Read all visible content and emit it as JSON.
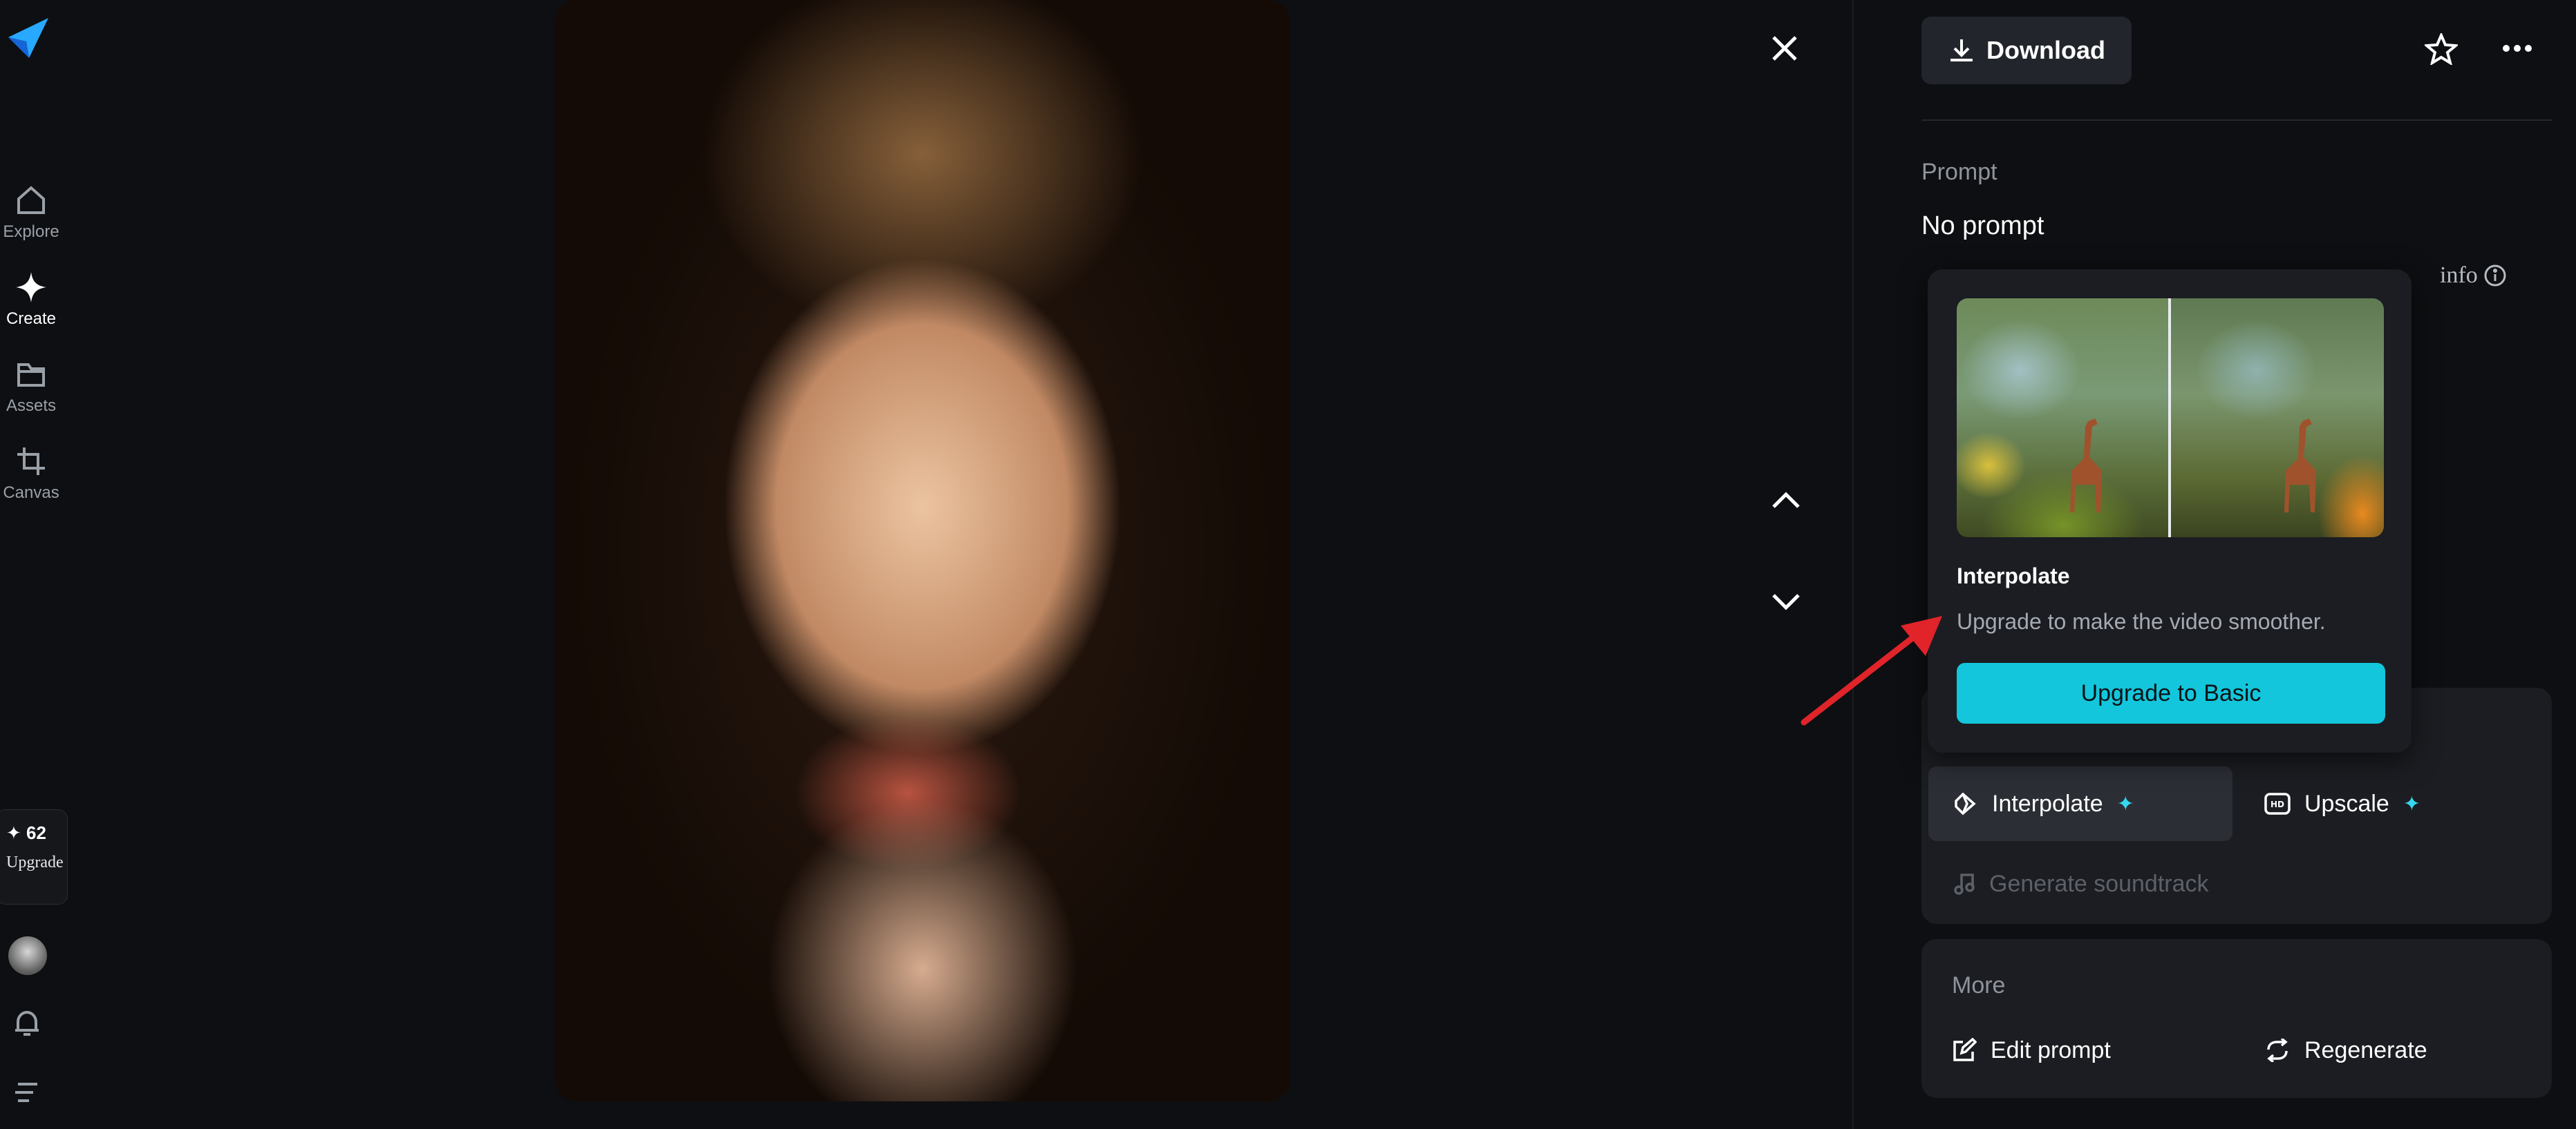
{
  "nav": {
    "items": [
      {
        "label": "Explore",
        "icon": "home-icon"
      },
      {
        "label": "Create",
        "icon": "sparkle-icon"
      },
      {
        "label": "Assets",
        "icon": "folder-icon"
      },
      {
        "label": "Canvas",
        "icon": "crop-icon"
      }
    ],
    "credits": {
      "count": "✦ 62",
      "upgrade": "Upgrade"
    }
  },
  "toolbar": {
    "download_label": "Download"
  },
  "details": {
    "prompt_title": "Prompt",
    "prompt_value": "No prompt",
    "info_text": "info"
  },
  "actions": {
    "interpolate": "Interpolate",
    "upscale": "Upscale",
    "generate_soundtrack": "Generate soundtrack"
  },
  "more": {
    "title": "More",
    "edit_prompt": "Edit prompt",
    "regenerate": "Regenerate"
  },
  "popup": {
    "title": "Interpolate",
    "description": "Upgrade to make the video smoother.",
    "button": "Upgrade to Basic"
  },
  "colors": {
    "accent": "#13c6dc",
    "arrow": "#e0242a"
  }
}
